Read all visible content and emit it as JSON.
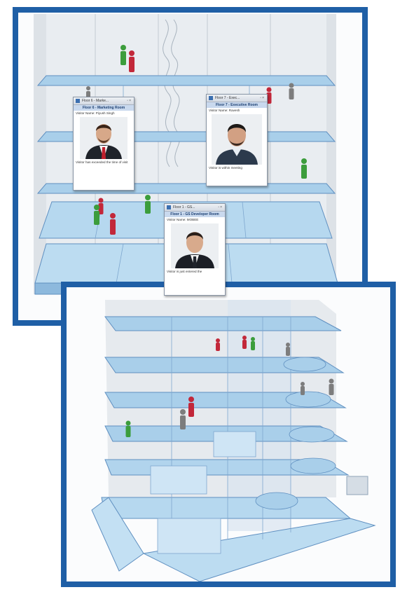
{
  "colors": {
    "frame_border": "#1f5fa6",
    "floor_fill": "#9fc9e8",
    "floor_edge": "#5f8fc0",
    "person_green": "#3c9d3c",
    "person_red": "#c2283a",
    "person_gray": "#7d7d7d",
    "popup_header": "#c9d9ee"
  },
  "top_view": {
    "popups": [
      {
        "window_title": "Floor 6 - Marke...",
        "room_name": "Floor 6 - Marketing Room",
        "visitor_line": "Visitor Name: Piyush Singh",
        "footer": "Visitor has exceeded the time of visit",
        "icon": "window-app-icon"
      },
      {
        "window_title": "Floor 7 - Exec...",
        "room_name": "Floor 7 - Executive Room",
        "visitor_line": "Visitor Name: Ravesh",
        "footer": "Visitor is within meeting",
        "icon": "window-app-icon"
      },
      {
        "window_title": "Floor 1 - GS...",
        "room_name": "Floor 1 - GS Developer Room",
        "visitor_line": "Visitor Name: MOBEE",
        "footer": "Visitor is just entered the",
        "icon": "window-app-icon"
      }
    ]
  }
}
